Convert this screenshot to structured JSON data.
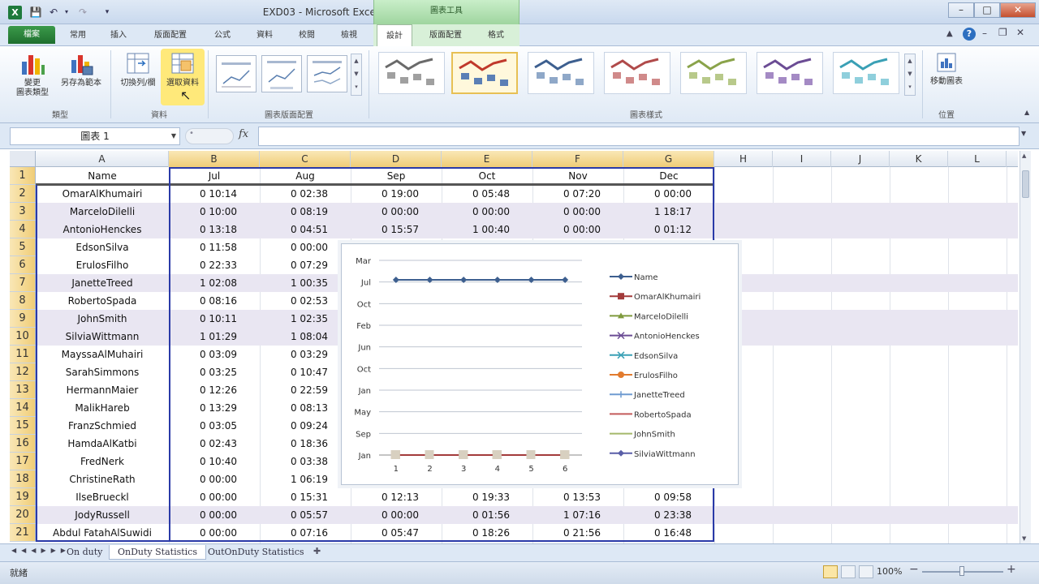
{
  "window": {
    "title": "EXD03 - Microsoft Excel",
    "context_header": "圖表工具",
    "controls": {
      "minimize": "–",
      "maximize": "□",
      "close": "✕"
    }
  },
  "tabs": {
    "file": "檔案",
    "items": [
      "常用",
      "插入",
      "版面配置",
      "公式",
      "資料",
      "校閱",
      "檢視"
    ],
    "context": [
      "設計",
      "版面配置",
      "格式"
    ]
  },
  "ribbon": {
    "change_type": "變更\n圖表類型",
    "save_template": "另存為範本",
    "switch_rowcol": "切換列/欄",
    "select_data": "選取資料",
    "move_chart": "移動圖表",
    "group_type": "類型",
    "group_data": "資料",
    "group_layouts": "圖表版面配置",
    "group_styles": "圖表樣式",
    "group_location": "位置"
  },
  "formula_bar": {
    "name_box": "圖表 1",
    "fx": "fx",
    "formula": ""
  },
  "columns": [
    "A",
    "B",
    "C",
    "D",
    "E",
    "F",
    "G",
    "H",
    "I",
    "J",
    "K",
    "L"
  ],
  "header_row": [
    "Name",
    "Jul",
    "Aug",
    "Sep",
    "Oct",
    "Nov",
    "Dec"
  ],
  "rows": [
    [
      "OmarAlKhumairi",
      "0 10:14",
      "0 02:38",
      "0 19:00",
      "0 05:48",
      "0 07:20",
      "0 00:00"
    ],
    [
      "MarceloDilelli",
      "0 10:00",
      "0 08:19",
      "0 00:00",
      "0 00:00",
      "0 00:00",
      "1 18:17"
    ],
    [
      "AntonioHenckes",
      "0 13:18",
      "0 04:51",
      "0 15:57",
      "1 00:40",
      "0 00:00",
      "0 01:12"
    ],
    [
      "EdsonSilva",
      "0 11:58",
      "0 00:00",
      "",
      "",
      "",
      ""
    ],
    [
      "ErulosFilho",
      "0 22:33",
      "0 07:29",
      "",
      "",
      "",
      ""
    ],
    [
      "JanetteTreed",
      "1 02:08",
      "1 00:35",
      "",
      "",
      "",
      ""
    ],
    [
      "RobertoSpada",
      "0 08:16",
      "0 02:53",
      "",
      "",
      "",
      ""
    ],
    [
      "JohnSmith",
      "0 10:11",
      "1 02:35",
      "",
      "",
      "",
      ""
    ],
    [
      "SilviaWittmann",
      "1 01:29",
      "1 08:04",
      "",
      "",
      "",
      ""
    ],
    [
      "MayssaAlMuhairi",
      "0 03:09",
      "0 03:29",
      "",
      "",
      "",
      ""
    ],
    [
      "SarahSimmons",
      "0 03:25",
      "0 10:47",
      "",
      "",
      "",
      ""
    ],
    [
      "HermannMaier",
      "0 12:26",
      "0 22:59",
      "",
      "",
      "",
      ""
    ],
    [
      "MalikHareb",
      "0 13:29",
      "0 08:13",
      "",
      "",
      "",
      ""
    ],
    [
      "FranzSchmied",
      "0 03:05",
      "0 09:24",
      "",
      "",
      "",
      ""
    ],
    [
      "HamdaAlKatbi",
      "0 02:43",
      "0 18:36",
      "",
      "",
      "",
      ""
    ],
    [
      "FredNerk",
      "0 10:40",
      "0 03:38",
      "",
      "",
      "",
      ""
    ],
    [
      "ChristineRath",
      "0 00:00",
      "1 06:19",
      "",
      "",
      "",
      ""
    ],
    [
      "IlseBrueckl",
      "0 00:00",
      "0 15:31",
      "0 12:13",
      "0 19:33",
      "0 13:53",
      "0 09:58"
    ],
    [
      "JodyRussell",
      "0 00:00",
      "0 05:57",
      "0 00:00",
      "0 01:56",
      "1 07:16",
      "0 23:38"
    ],
    [
      "Abdul FatahAlSuwidi",
      "0 00:00",
      "0 07:16",
      "0 05:47",
      "0 18:26",
      "0 21:56",
      "0 16:48"
    ]
  ],
  "sheet_tabs": [
    "On duty",
    "OnDuty Statistics",
    "OutOnDuty Statistics"
  ],
  "status": {
    "ready": "就緒",
    "zoom": "100%",
    "minus": "−",
    "plus": "+"
  },
  "chart_data": {
    "type": "line",
    "x": [
      1,
      2,
      3,
      4,
      5,
      6
    ],
    "y_tick_labels": [
      "Mar",
      "Jul",
      "Oct",
      "Feb",
      "Jun",
      "Oct",
      "Jan",
      "May",
      "Sep",
      "Jan"
    ],
    "series": [
      {
        "name": "Name",
        "color": "#3d5f8f",
        "marker": "diamond",
        "level": 0.9
      },
      {
        "name": "OmarAlKhumairi",
        "color": "#a33b3b",
        "marker": "square",
        "level": 0
      },
      {
        "name": "MarceloDilelli",
        "color": "#7f9a3d",
        "marker": "triangle",
        "level": 0
      },
      {
        "name": "AntonioHenckes",
        "color": "#6b4c94",
        "marker": "x",
        "level": 0
      },
      {
        "name": "EdsonSilva",
        "color": "#3aa0b5",
        "marker": "x",
        "level": 0
      },
      {
        "name": "ErulosFilho",
        "color": "#e27b2e",
        "marker": "circle",
        "level": 0
      },
      {
        "name": "JanetteTreed",
        "color": "#6f9bd1",
        "marker": "plus",
        "level": 0
      },
      {
        "name": "RobertoSpada",
        "color": "#c35a5a",
        "marker": "none",
        "level": 0
      },
      {
        "name": "JohnSmith",
        "color": "#a4b86a",
        "marker": "none",
        "level": 0
      },
      {
        "name": "SilviaWittmann",
        "color": "#5a5fa8",
        "marker": "diamond",
        "level": 0
      }
    ],
    "grid": true,
    "legend": "right"
  }
}
